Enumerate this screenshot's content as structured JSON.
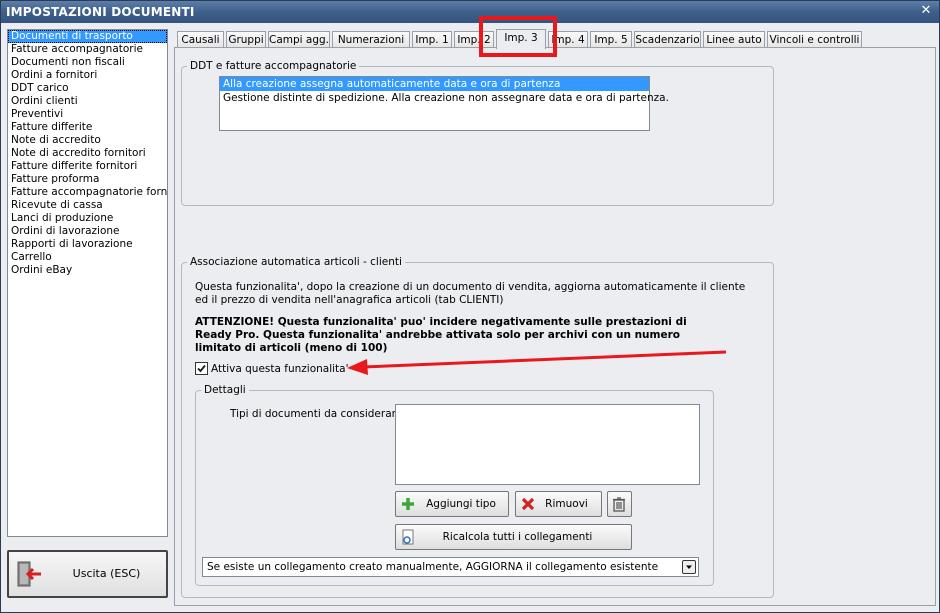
{
  "window": {
    "title": "IMPOSTAZIONI DOCUMENTI",
    "close_icon": "close-icon"
  },
  "documents": [
    "Documenti di trasporto",
    "Fatture accompagnatorie",
    "Documenti non fiscali",
    "Ordini a fornitori",
    "DDT carico",
    "Ordini clienti",
    "Preventivi",
    "Fatture differite",
    "Note di accredito",
    "Note di accredito fornitori",
    "Fatture differite fornitori",
    "Fatture proforma",
    "Fatture accompagnatorie fornito",
    "Ricevute di cassa",
    "Lanci di produzione",
    "Ordini di lavorazione",
    "Rapporti di lavorazione",
    "Carrello",
    "Ordini eBay"
  ],
  "selected_document": "Documenti di trasporto",
  "exit_button": {
    "label": "Uscita (ESC)"
  },
  "tabs": [
    "Causali",
    "Gruppi",
    "Campi agg.",
    "Numerazioni",
    "Imp. 1",
    "Imp. 2",
    "Imp. 3",
    "Imp. 4",
    "Imp. 5",
    "Scadenzario",
    "Linee auto",
    "Vincoli e controlli"
  ],
  "active_tab": "Imp. 3",
  "ddt_group": {
    "legend": "DDT e fatture accompagnatorie",
    "options": [
      "Alla creazione assegna automaticamente data e ora di partenza",
      "Gestione distinte di spedizione. Alla creazione non assegnare data e ora di partenza."
    ],
    "selected": "Alla creazione assegna automaticamente data e ora di partenza"
  },
  "assoc_group": {
    "legend": "Associazione automatica articoli - clienti",
    "description_line1": "Questa funzionalita', dopo la creazione di un documento di vendita, aggiorna automaticamente il cliente",
    "description_line2": "ed il prezzo di vendita nell'anagrafica articoli (tab CLIENTI)",
    "warning_line1": "ATTENZIONE! Questa funzionalita' puo' incidere negativamente sulle prestazioni di",
    "warning_line2": "Ready Pro. Questa funzionalita' andrebbe attivata solo per archivi con un numero",
    "warning_line3": "limitato di articoli (meno di 100)",
    "checkbox_label": "Attiva questa funzionalita'",
    "checkbox_checked": true
  },
  "details": {
    "legend": "Dettagli",
    "tipi_label": "Tipi di documenti da considerare:",
    "add_button": "Aggiungi tipo",
    "remove_button": "Rimuovi",
    "recalc_button": "Ricalcola tutti i collegamenti",
    "select_value": "Se esiste un collegamento creato manualmente, AGGIORNA il collegamento esistente"
  },
  "colors": {
    "selection": "#3399ff",
    "highlight": "#e8181c",
    "title_bar": "#3d5f8a"
  }
}
